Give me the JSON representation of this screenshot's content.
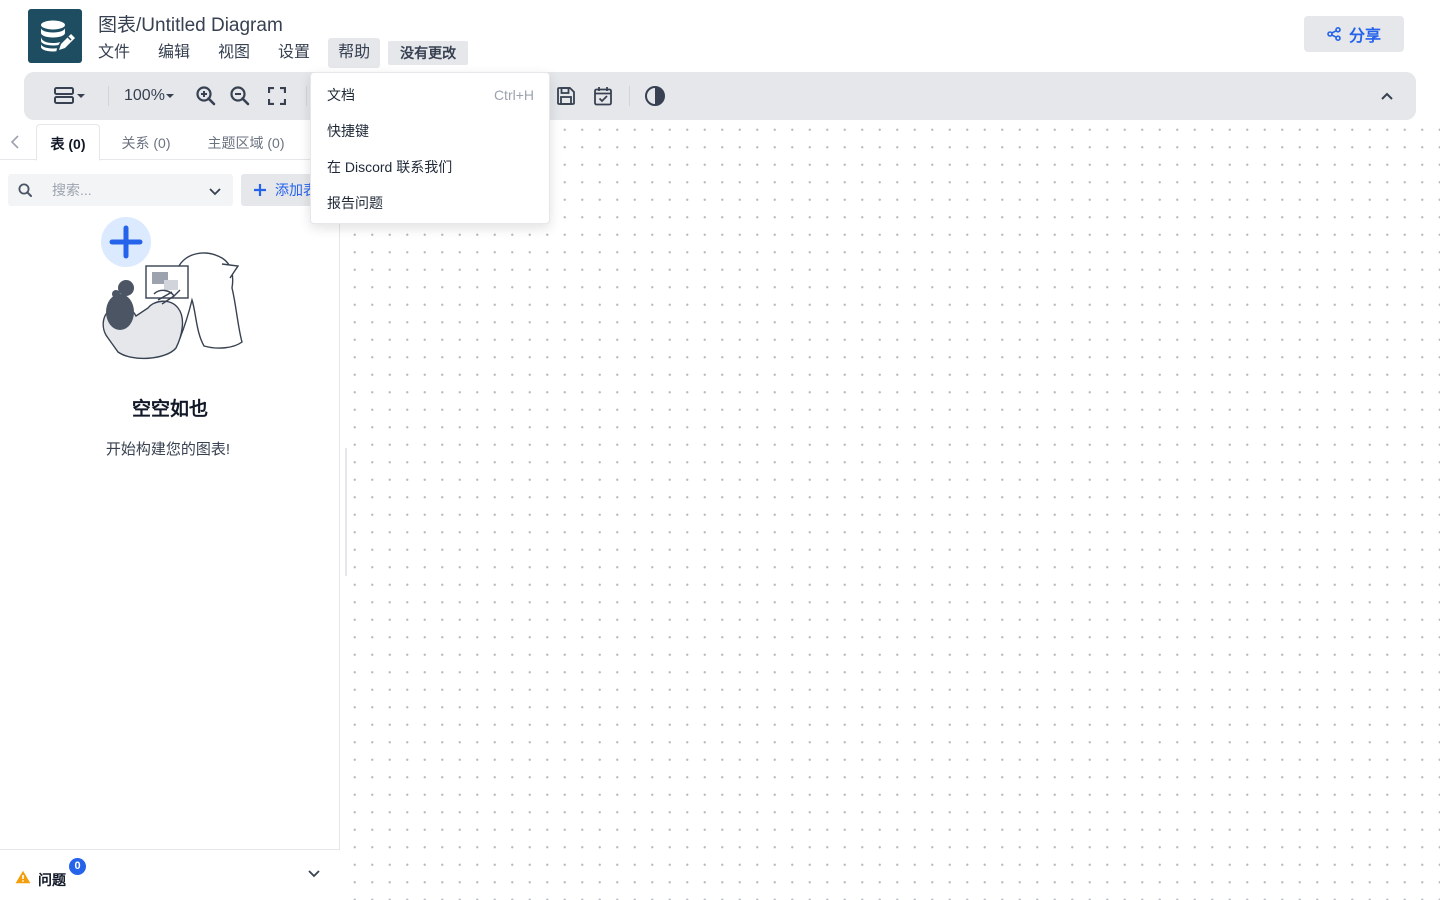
{
  "header": {
    "title": "图表/Untitled Diagram",
    "menus": [
      "文件",
      "编辑",
      "视图",
      "设置",
      "帮助"
    ],
    "active_menu": "帮助",
    "save_status": "没有更改",
    "share_label": "分享"
  },
  "toolbar": {
    "zoom": "100%",
    "icons": [
      "layout-icon",
      "chevron-down-icon",
      "zoom-in-icon",
      "zoom-out-icon",
      "fullscreen-icon",
      "save-icon",
      "calendar-check-icon",
      "theme-toggle-icon",
      "chevron-up-icon"
    ]
  },
  "help_menu": {
    "items": [
      {
        "label": "文档",
        "shortcut": "Ctrl+H"
      },
      {
        "label": "快捷键",
        "shortcut": ""
      },
      {
        "label": "在 Discord 联系我们",
        "shortcut": ""
      },
      {
        "label": "报告问题",
        "shortcut": ""
      }
    ]
  },
  "sidebar": {
    "tabs": [
      {
        "label": "表 (0)",
        "active": true
      },
      {
        "label": "关系 (0)",
        "active": false
      },
      {
        "label": "主题区域 (0)",
        "active": false
      }
    ],
    "search_placeholder": "搜索...",
    "add_table_label": "添加表",
    "empty_title": "空空如也",
    "empty_subtitle": "开始构建您的图表!",
    "issues_label": "问题",
    "issues_count": "0"
  },
  "colors": {
    "accent": "#2563eb",
    "logo_bg": "#1e4d61",
    "toolbar_bg": "#e5e7eb",
    "warning": "#f59e0b"
  }
}
